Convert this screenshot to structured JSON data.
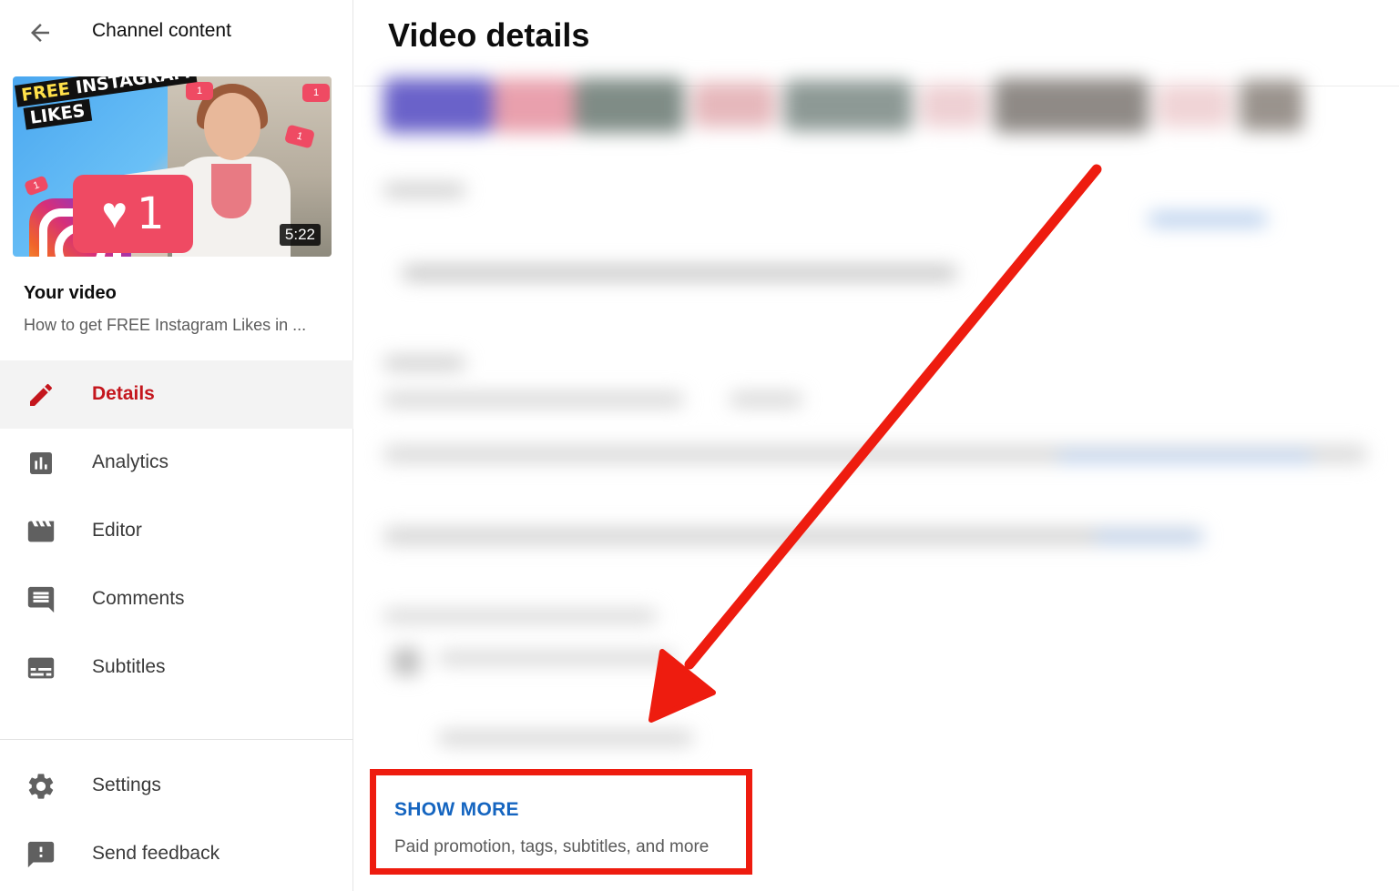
{
  "sidebar": {
    "header_title": "Channel content",
    "thumbnail": {
      "title_word_1": "FREE",
      "title_word_2": "INSTAGRAM",
      "title_word_3": "LIKES",
      "like_count": "1",
      "mini_badge_count": "1",
      "duration": "5:22"
    },
    "your_video_label": "Your video",
    "video_title": "How to get FREE Instagram Likes in ...",
    "nav_items": [
      {
        "label": "Details",
        "icon": "pencil-icon",
        "active": true
      },
      {
        "label": "Analytics",
        "icon": "analytics-icon",
        "active": false
      },
      {
        "label": "Editor",
        "icon": "clapperboard-icon",
        "active": false
      },
      {
        "label": "Comments",
        "icon": "comment-icon",
        "active": false
      },
      {
        "label": "Subtitles",
        "icon": "subtitles-icon",
        "active": false
      }
    ],
    "bottom_items": [
      {
        "label": "Settings",
        "icon": "gear-icon"
      },
      {
        "label": "Send feedback",
        "icon": "feedback-icon"
      }
    ]
  },
  "main": {
    "title": "Video details",
    "show_more": {
      "label": "SHOW MORE",
      "description": "Paid promotion, tags, subtitles, and more"
    }
  },
  "colors": {
    "active_red": "#c4161d",
    "annotation_red": "#ee1c0f",
    "link_blue": "#1565c0"
  }
}
